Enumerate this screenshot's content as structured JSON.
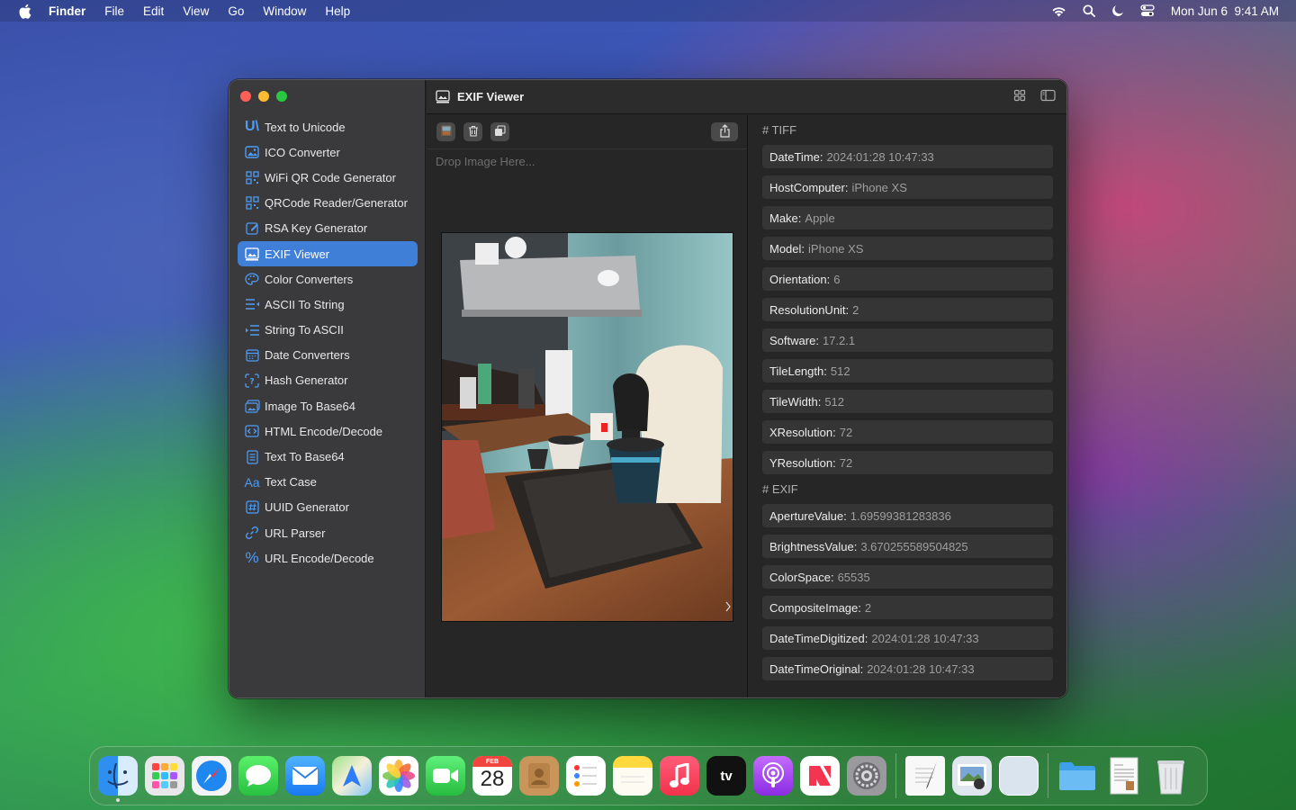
{
  "menubar": {
    "app_name": "Finder",
    "menus": [
      "File",
      "Edit",
      "View",
      "Go",
      "Window",
      "Help"
    ],
    "clock": "Mon Jun 6  9:41 AM"
  },
  "window": {
    "title": "EXIF Viewer",
    "sidebar": [
      {
        "label": "Text to Unicode",
        "icon": "unicode-icon"
      },
      {
        "label": "ICO Converter",
        "icon": "image-icon"
      },
      {
        "label": "WiFi QR Code Generator",
        "icon": "qrcode-icon"
      },
      {
        "label": "QRCode Reader/Generator",
        "icon": "qrcode-icon"
      },
      {
        "label": "RSA Key Generator",
        "icon": "pencil-square-icon"
      },
      {
        "label": "EXIF Viewer",
        "icon": "photo-icon",
        "selected": true
      },
      {
        "label": "Color Converters",
        "icon": "palette-icon"
      },
      {
        "label": "ASCII To String",
        "icon": "list-arrow-left-icon"
      },
      {
        "label": "String To ASCII",
        "icon": "list-arrow-right-icon"
      },
      {
        "label": "Date Converters",
        "icon": "calendar-icon"
      },
      {
        "label": "Hash Generator",
        "icon": "hash-icon"
      },
      {
        "label": "Image To Base64",
        "icon": "images-icon"
      },
      {
        "label": "HTML Encode/Decode",
        "icon": "code-icon"
      },
      {
        "label": "Text To Base64",
        "icon": "document-icon"
      },
      {
        "label": "Text Case",
        "icon": "textcase-icon"
      },
      {
        "label": "UUID Generator",
        "icon": "number-icon"
      },
      {
        "label": "URL Parser",
        "icon": "link-icon"
      },
      {
        "label": "URL Encode/Decode",
        "icon": "percent-icon"
      }
    ],
    "drop_placeholder": "Drop Image Here...",
    "sections": [
      {
        "heading": "# TIFF",
        "rows": [
          {
            "key": "DateTime",
            "value": "2024:01:28 10:47:33"
          },
          {
            "key": "HostComputer",
            "value": "iPhone XS"
          },
          {
            "key": "Make",
            "value": "Apple"
          },
          {
            "key": "Model",
            "value": "iPhone XS"
          },
          {
            "key": "Orientation",
            "value": "6"
          },
          {
            "key": "ResolutionUnit",
            "value": "2"
          },
          {
            "key": "Software",
            "value": "17.2.1"
          },
          {
            "key": "TileLength",
            "value": "512"
          },
          {
            "key": "TileWidth",
            "value": "512"
          },
          {
            "key": "XResolution",
            "value": "72"
          },
          {
            "key": "YResolution",
            "value": "72"
          }
        ]
      },
      {
        "heading": "# EXIF",
        "rows": [
          {
            "key": "ApertureValue",
            "value": "1.69599381283836"
          },
          {
            "key": "BrightnessValue",
            "value": "3.670255589504825"
          },
          {
            "key": "ColorSpace",
            "value": "65535"
          },
          {
            "key": "CompositeImage",
            "value": "2"
          },
          {
            "key": "DateTimeDigitized",
            "value": "2024:01:28 10:47:33"
          },
          {
            "key": "DateTimeOriginal",
            "value": "2024:01:28 10:47:33"
          }
        ]
      }
    ]
  },
  "dock": {
    "apps": [
      "Finder",
      "Launchpad",
      "Safari",
      "Messages",
      "Mail",
      "Maps",
      "Photos",
      "FaceTime",
      "Calendar",
      "Contacts",
      "Reminders",
      "Notes",
      "Music",
      "TV",
      "Podcasts",
      "News",
      "System Settings",
      "TextEdit",
      "Preview",
      "Blank App",
      "Folder",
      "Document",
      "Trash"
    ],
    "calendar_month": "FEB",
    "calendar_day": "28",
    "tv_label": "tv"
  }
}
